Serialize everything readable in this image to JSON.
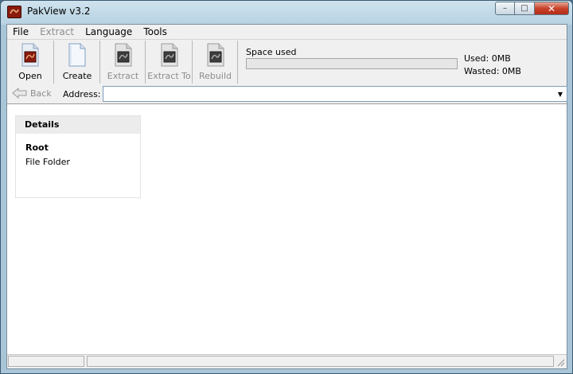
{
  "window": {
    "title": "PakView v3.2",
    "controls": {
      "minimize": "–",
      "maximize": "□",
      "close": "✕"
    }
  },
  "menu": [
    {
      "label": "File",
      "enabled": true
    },
    {
      "label": "Extract",
      "enabled": false
    },
    {
      "label": "Language",
      "enabled": true
    },
    {
      "label": "Tools",
      "enabled": true
    }
  ],
  "toolbar": {
    "buttons": [
      {
        "label": "Open",
        "icon": "open-file-icon",
        "enabled": true
      },
      {
        "label": "Create",
        "icon": "new-file-icon",
        "enabled": true
      },
      {
        "label": "Extract",
        "icon": "extract-icon",
        "enabled": false
      },
      {
        "label": "Extract To",
        "icon": "extract-to-icon",
        "enabled": false
      },
      {
        "label": "Rebuild",
        "icon": "rebuild-icon",
        "enabled": false
      }
    ],
    "space": {
      "label": "Space used",
      "used": "Used: 0MB",
      "wasted": "Wasted: 0MB",
      "fraction": 0
    }
  },
  "address": {
    "back_label": "Back",
    "label": "Address:",
    "value": ""
  },
  "details": {
    "header": "Details",
    "name": "Root",
    "type": "File Folder"
  },
  "colors": {
    "app_icon": "#8b1a0e",
    "close_button": "#c8432c",
    "disabled_text": "#8d8d8d"
  }
}
